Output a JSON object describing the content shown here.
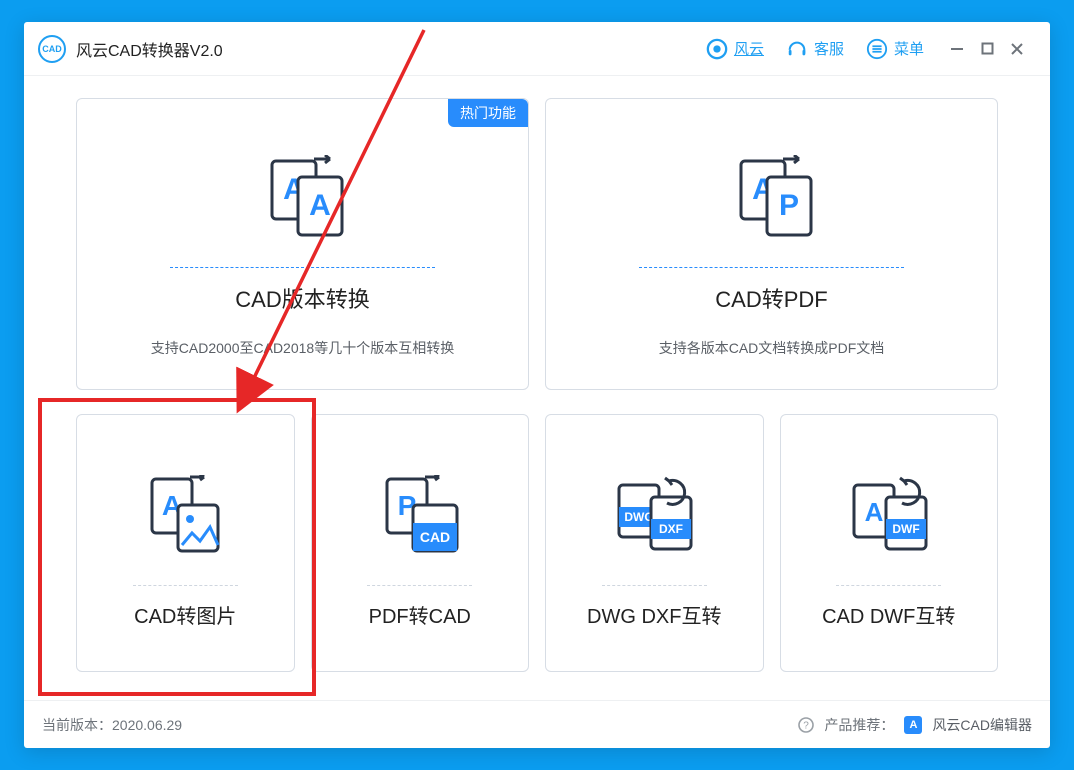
{
  "titlebar": {
    "app_title": "风云CAD转换器V2.0",
    "fengyun_label": "风云",
    "kefu_label": "客服",
    "menu_label": "菜单"
  },
  "badge_hot": "热门功能",
  "cards": {
    "version_convert": {
      "title": "CAD版本转换",
      "desc": "支持CAD2000至CAD2018等几十个版本互相转换"
    },
    "cad_to_pdf": {
      "title": "CAD转PDF",
      "desc": "支持各版本CAD文档转换成PDF文档"
    },
    "cad_to_image": {
      "title": "CAD转图片"
    },
    "pdf_to_cad": {
      "title": "PDF转CAD"
    },
    "dwg_dxf": {
      "title": "DWG DXF互转"
    },
    "cad_dwf": {
      "title": "CAD DWF互转"
    }
  },
  "status": {
    "version_label": "当前版本：",
    "version_value": "2020.06.29",
    "recommend_label": "产品推荐：",
    "recommend_product": "风云CAD编辑器"
  },
  "icons": {
    "app": "cad-app-icon",
    "fengyun": "target-icon",
    "kefu": "headset-icon",
    "menu": "menu-circle-icon",
    "help": "help-icon"
  },
  "colors": {
    "brand_blue": "#288cfc",
    "line_blue": "#1f9ff2",
    "text": "#222",
    "muted": "#6d737a",
    "annotation_red": "#e62727"
  }
}
